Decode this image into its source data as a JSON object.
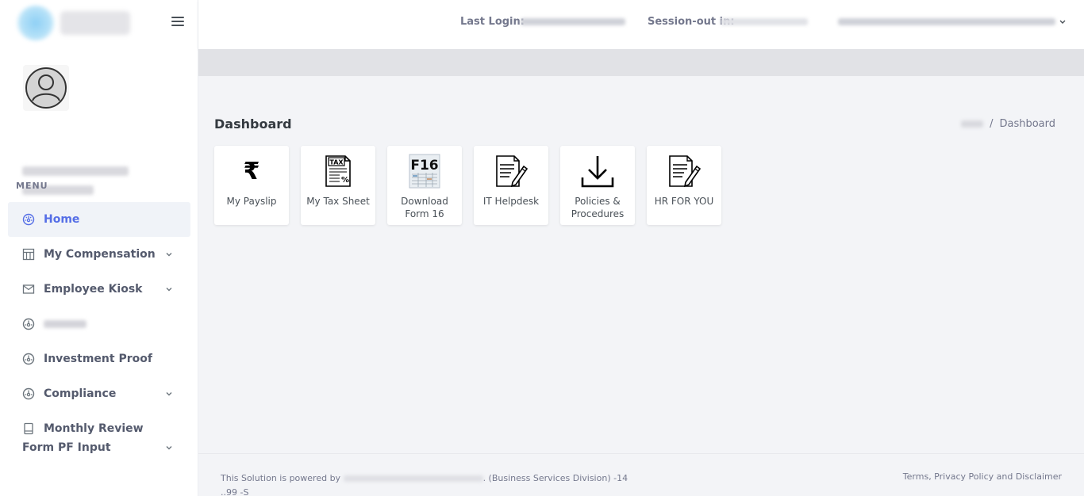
{
  "sidebar": {
    "menu_title": "MENU",
    "items": [
      {
        "label": "Home",
        "icon": "dashboard-icon",
        "active": true
      },
      {
        "label": "My Compensation",
        "icon": "table-icon"
      },
      {
        "label": "Employee Kiosk",
        "icon": "mail-icon"
      },
      {
        "label": "",
        "icon": "dashboard-icon"
      },
      {
        "label": "Investment Proof",
        "icon": "dashboard-icon"
      },
      {
        "label": "Compliance",
        "icon": "dashboard-icon"
      },
      {
        "label": "Monthly Review Form PF Input",
        "icon": "document-icon"
      }
    ]
  },
  "topbar": {
    "last_login_label": "Last Login:",
    "session_out_label": "Session-out in:"
  },
  "main": {
    "page_title": "Dashboard",
    "breadcrumb_current": "Dashboard",
    "breadcrumb_separator": "/",
    "tiles": [
      {
        "label": "My Payslip",
        "icon": "rupee-icon"
      },
      {
        "label": "My Tax Sheet",
        "icon": "tax-sheet-icon"
      },
      {
        "label": "Download Form 16",
        "icon": "form16-icon",
        "icon_text": "F16"
      },
      {
        "label": "IT Helpdesk",
        "icon": "document-pen-icon"
      },
      {
        "label": "Policies & Procedures",
        "icon": "download-icon"
      },
      {
        "label": "HR FOR YOU",
        "icon": "document-pen-icon"
      }
    ],
    "tax_icon_text": "TAX",
    "rupee_symbol": "₹"
  },
  "footer": {
    "powered_prefix": "This Solution is powered by",
    "powered_suffix": ". (Business Services Division) -14",
    "powered_line2": "..99 -S",
    "links": "Terms, Privacy Policy and Disclaimer"
  },
  "colors": {
    "accent": "#556ee6",
    "sidebar_bg": "#ffffff",
    "page_bg": "#f3f4f7"
  }
}
